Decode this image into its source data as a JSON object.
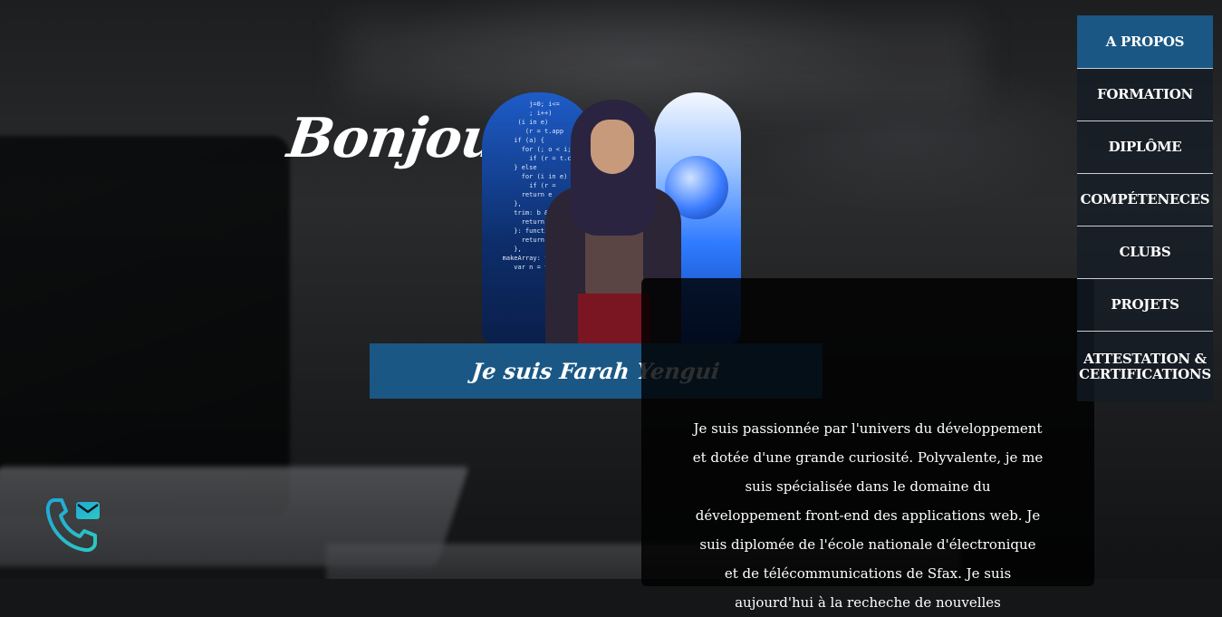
{
  "hero": {
    "greeting": "Bonjour!",
    "name_line": "Je suis Farah Yengui"
  },
  "about": {
    "text": "Je suis passionnée par l'univers du développement et dotée d'une grande curiosité. Polyvalente, je me suis spécialisée dans le domaine du développement front-end des applications web. Je suis diplomée de l'école nationale d'électronique et de télécommunications de Sfax. Je suis aujourd'hui à la recheche de nouvelles"
  },
  "nav": {
    "items": [
      {
        "label": "A PROPOS",
        "active": true
      },
      {
        "label": "FORMATION",
        "active": false
      },
      {
        "label": "DIPLÔME",
        "active": false
      },
      {
        "label": "COMPÉTENECES",
        "active": false
      },
      {
        "label": "CLUBS",
        "active": false
      },
      {
        "label": "PROJETS",
        "active": false
      },
      {
        "label": "ATTESTATION & CERTIFICATIONS",
        "active": false
      }
    ]
  },
  "contact": {
    "icon": "phone-mail-icon"
  },
  "colors": {
    "accent": "#1a5784",
    "contact_icon_gradient": [
      "#1fa8d8",
      "#2cc8c0"
    ],
    "card_bg": "#000000"
  }
}
